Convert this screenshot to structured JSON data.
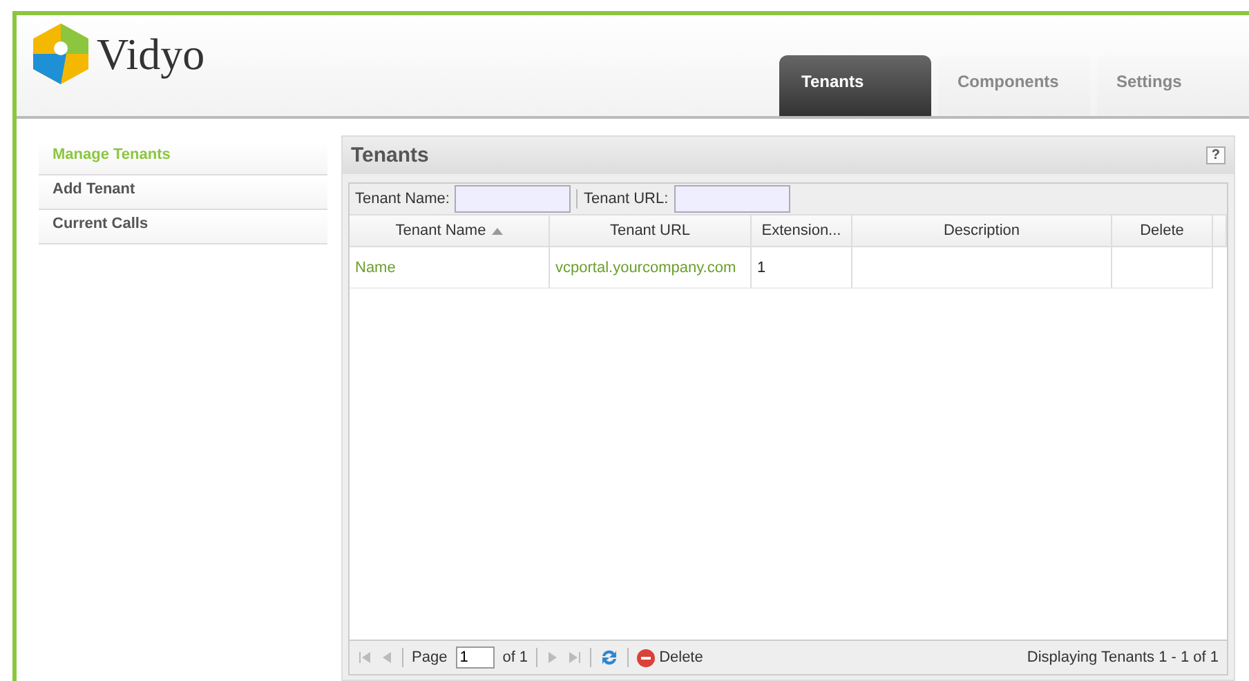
{
  "header": {
    "logo_text": "Vidyo",
    "tabs": [
      {
        "label": "Tenants",
        "selected": true
      },
      {
        "label": "Components",
        "selected": false
      },
      {
        "label": "Settings",
        "selected": false
      }
    ]
  },
  "sidebar": {
    "items": [
      {
        "label": "Manage Tenants",
        "selected": true
      },
      {
        "label": "Add Tenant",
        "selected": false
      },
      {
        "label": "Current Calls",
        "selected": false
      }
    ]
  },
  "panel": {
    "title": "Tenants",
    "help": "?",
    "filters": [
      {
        "label": "Tenant Name:"
      },
      {
        "label": "Tenant URL:"
      }
    ],
    "table": {
      "columns": [
        {
          "label": "Tenant Name",
          "sorted": true
        },
        {
          "label": "Tenant URL",
          "sorted": false
        },
        {
          "label": "Extension...",
          "sorted": false
        },
        {
          "label": "Description",
          "sorted": false
        },
        {
          "label": "Delete",
          "sorted": false
        }
      ],
      "rows": [
        [
          "Name",
          "vcportal.yourcompany.com",
          "1",
          "",
          ""
        ]
      ]
    },
    "pager": {
      "page_label": "Page",
      "page": "1",
      "of": "of 1",
      "delete": "Delete",
      "display": "Displaying Tenants 1 - 1 of 1"
    }
  }
}
